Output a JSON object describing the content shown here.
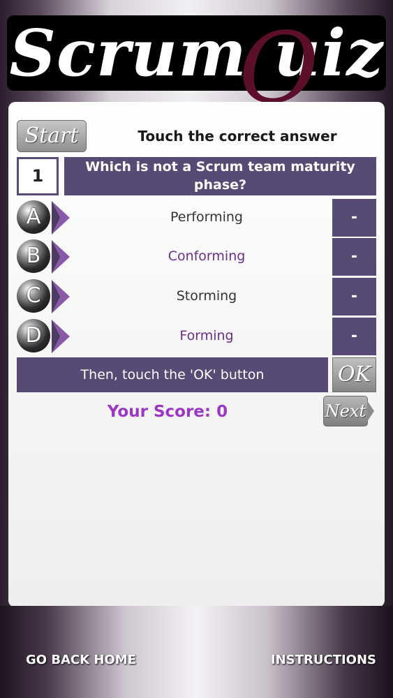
{
  "app": {
    "logo_text": "Scrum  uiz",
    "logo_q": "Q"
  },
  "quiz": {
    "start_label": "Start",
    "instruction": "Touch the correct answer",
    "question_number": "1",
    "question": "Which is not a Scrum team maturity phase?",
    "answers": [
      {
        "letter": "A",
        "text": "Performing",
        "mark": "-",
        "text_color": "#333333"
      },
      {
        "letter": "B",
        "text": "Conforming",
        "mark": "-",
        "text_color": "#6a2f8a"
      },
      {
        "letter": "C",
        "text": "Storming",
        "mark": "-",
        "text_color": "#333333"
      },
      {
        "letter": "D",
        "text": "Forming",
        "mark": "-",
        "text_color": "#6a2f8a"
      }
    ],
    "then_instruction": "Then, touch the 'OK' button",
    "ok_label": "OK",
    "score_text": "Your Score: 0",
    "next_label": "Next"
  },
  "footer": {
    "home_label": "GO BACK HOME",
    "instructions_label": "INSTRUCTIONS"
  },
  "colors": {
    "accent_purple": "#574a75",
    "score_purple": "#9b37c3",
    "logo_q_color": "#5c0f2a"
  },
  "icons": {
    "answer_arrow": "triangle-right-icon",
    "next_arrow": "chevron-right-icon"
  }
}
